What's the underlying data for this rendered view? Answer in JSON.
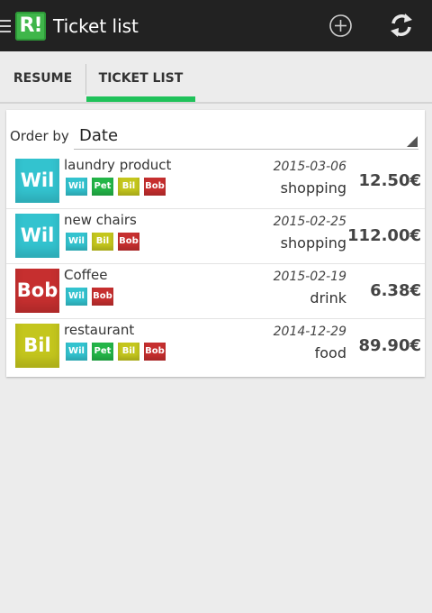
{
  "app": {
    "logo_text": "R!",
    "title": "Ticket list",
    "icons": {
      "menu": "menu-icon",
      "add": "add-circle-icon",
      "refresh": "refresh-icon"
    }
  },
  "tabs": [
    {
      "label": "RESUME",
      "selected": false
    },
    {
      "label": "TICKET LIST",
      "selected": true
    }
  ],
  "order": {
    "label": "Order by",
    "value": "Date"
  },
  "colors": {
    "Wil": "#33c3cf",
    "Pet": "#23b548",
    "Bil": "#c4c61d",
    "Bob": "#c62f2f",
    "accent": "#1fc25a"
  },
  "tickets": [
    {
      "avatar": "Wil",
      "title": "laundry product",
      "participants": [
        "Wil",
        "Pet",
        "Bil",
        "Bob"
      ],
      "date": "2015-03-06",
      "category": "shopping",
      "amount": "12.50€"
    },
    {
      "avatar": "Wil",
      "title": "new chairs",
      "participants": [
        "Wil",
        "Bil",
        "Bob"
      ],
      "date": "2015-02-25",
      "category": "shopping",
      "amount": "112.00€"
    },
    {
      "avatar": "Bob",
      "title": "Coffee",
      "participants": [
        "Wil",
        "Bob"
      ],
      "date": "2015-02-19",
      "category": "drink",
      "amount": "6.38€"
    },
    {
      "avatar": "Bil",
      "title": "restaurant",
      "participants": [
        "Wil",
        "Pet",
        "Bil",
        "Bob"
      ],
      "date": "2014-12-29",
      "category": "food",
      "amount": "89.90€"
    }
  ]
}
